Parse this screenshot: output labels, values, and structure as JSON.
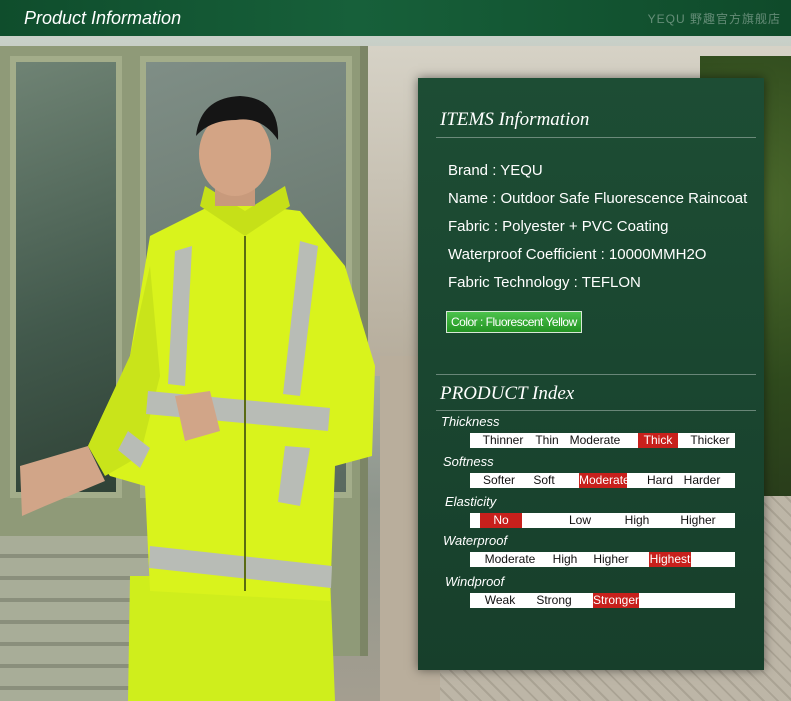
{
  "header": {
    "title": "Product Information",
    "shop_watermark": "YEQU 野趣官方旗舰店"
  },
  "items_section": {
    "title": "ITEMS Information",
    "brand": "Brand :  YEQU",
    "name": "Name : Outdoor Safe Fluorescence Raincoat",
    "fabric": "Fabric : Polyester + PVC Coating",
    "waterproof_coefficient": "Waterproof Coefficient : 10000MMH2O",
    "fabric_technology": "Fabric Technology : TEFLON",
    "color": "Color : Fluorescent Yellow"
  },
  "index_section": {
    "title": "PRODUCT  Index",
    "rows": [
      {
        "label": "Thickness",
        "options": [
          "Thinner",
          "Thin",
          "Moderate",
          "Thick",
          "Thicker"
        ],
        "selected": 3
      },
      {
        "label": "Softness",
        "options": [
          "Softer",
          "Soft",
          "Moderate",
          "Hard",
          "Harder"
        ],
        "selected": 2
      },
      {
        "label": "Elasticity",
        "options": [
          "No",
          "Low",
          "High",
          "Higher"
        ],
        "selected": 0
      },
      {
        "label": "Waterproof",
        "options": [
          "Moderate",
          "High",
          "Higher",
          "Highest"
        ],
        "selected": 3
      },
      {
        "label": "Windproof",
        "options": [
          "Weak",
          "Strong",
          "Stronger"
        ],
        "selected": 2
      }
    ]
  },
  "colors": {
    "panel_green": "#1a4630",
    "header_green": "#17603a",
    "selected_red": "#c8201c",
    "badge_green": "#239423",
    "jacket_yellow": "#d8f21a"
  }
}
